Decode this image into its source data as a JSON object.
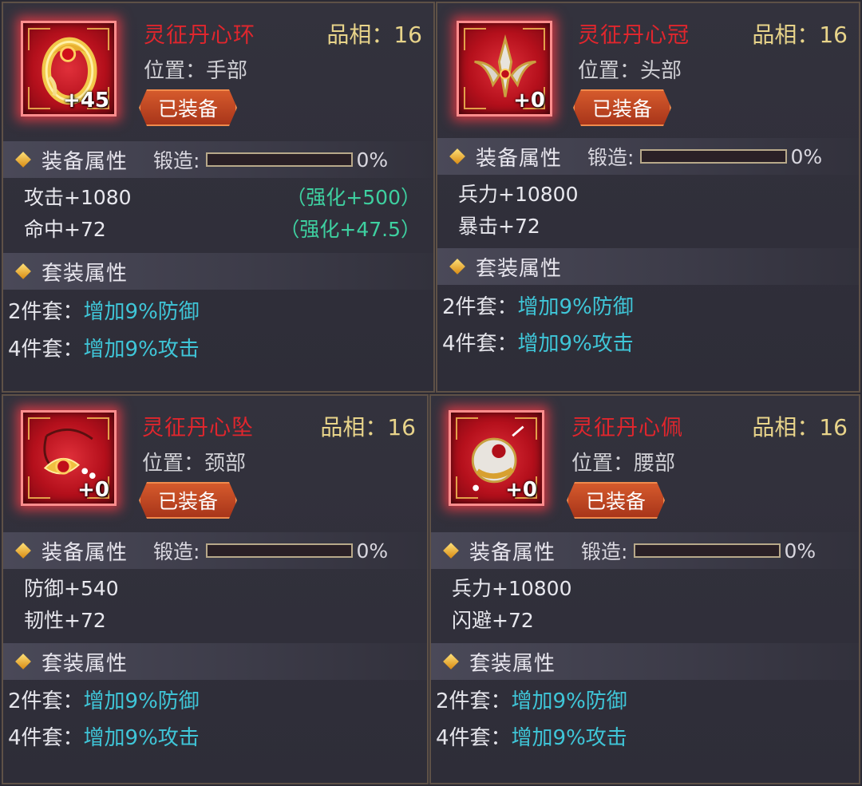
{
  "cards": [
    {
      "name": "灵征丹心环",
      "grade": "品相：16",
      "slot": "位置：手部",
      "level": "+45",
      "equipped_label": "已装备",
      "icon": "ring-icon",
      "attr_title": "装备属性",
      "forge_label": "锻造:",
      "forge_progress": 0,
      "forge_pct": "0%",
      "stats": [
        {
          "text": "攻击+1080",
          "bonus": "（强化+500）"
        },
        {
          "text": "命中+72",
          "bonus": "（强化+47.5）"
        }
      ],
      "set_title": "套装属性",
      "sets": [
        {
          "label": "2件套：",
          "effect": "增加9%防御"
        },
        {
          "label": "4件套：",
          "effect": "增加9%攻击"
        }
      ]
    },
    {
      "name": "灵征丹心冠",
      "grade": "品相：16",
      "slot": "位置：头部",
      "level": "+0",
      "equipped_label": "已装备",
      "icon": "crown-icon",
      "attr_title": "装备属性",
      "forge_label": "锻造:",
      "forge_progress": 0,
      "forge_pct": "0%",
      "stats": [
        {
          "text": "兵力+10800",
          "bonus": ""
        },
        {
          "text": "暴击+72",
          "bonus": ""
        }
      ],
      "set_title": "套装属性",
      "sets": [
        {
          "label": "2件套：",
          "effect": "增加9%防御"
        },
        {
          "label": "4件套：",
          "effect": "增加9%攻击"
        }
      ]
    },
    {
      "name": "灵征丹心坠",
      "grade": "品相：16",
      "slot": "位置：颈部",
      "level": "+0",
      "equipped_label": "已装备",
      "icon": "pendant-icon",
      "attr_title": "装备属性",
      "forge_label": "锻造:",
      "forge_progress": 0,
      "forge_pct": "0%",
      "stats": [
        {
          "text": "防御+540",
          "bonus": ""
        },
        {
          "text": "韧性+72",
          "bonus": ""
        }
      ],
      "set_title": "套装属性",
      "sets": [
        {
          "label": "2件套：",
          "effect": "增加9%防御"
        },
        {
          "label": "4件套：",
          "effect": "增加9%攻击"
        }
      ]
    },
    {
      "name": "灵征丹心佩",
      "grade": "品相：16",
      "slot": "位置：腰部",
      "level": "+0",
      "equipped_label": "已装备",
      "icon": "jade-pendant-icon",
      "attr_title": "装备属性",
      "forge_label": "锻造:",
      "forge_progress": 0,
      "forge_pct": "0%",
      "stats": [
        {
          "text": "兵力+10800",
          "bonus": ""
        },
        {
          "text": "闪避+72",
          "bonus": ""
        }
      ],
      "set_title": "套装属性",
      "sets": [
        {
          "label": "2件套：",
          "effect": "增加9%防御"
        },
        {
          "label": "4件套：",
          "effect": "增加9%攻击"
        }
      ]
    }
  ]
}
